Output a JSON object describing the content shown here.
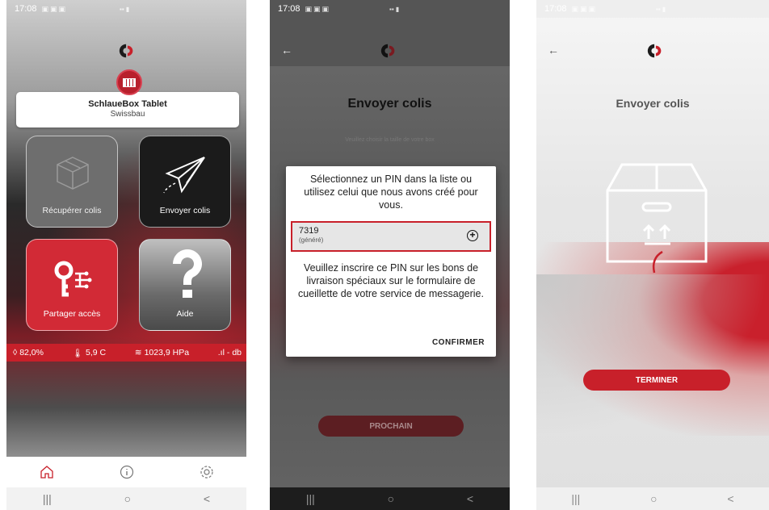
{
  "status_time": "17:08",
  "colors": {
    "brand_red": "#c8202a",
    "dark": "#1b1b1b"
  },
  "screen1": {
    "device_name": "SchlaueBox Tablet",
    "device_sub": "Swissbau",
    "tiles": {
      "recuperer": "Récupérer colis",
      "envoyer": "Envoyer colis",
      "partager": "Partager accès",
      "aide": "Aide"
    },
    "sensors": {
      "humidity": "82,0%",
      "temperature": "5,9 C",
      "pressure": "1023,9 HPa",
      "signal": "- db"
    },
    "nav_icons": [
      "home-icon",
      "info-icon",
      "gear-icon"
    ]
  },
  "screen2": {
    "title": "Envoyer colis",
    "subtitle": "Veuillez choisir la taille de votre box",
    "dialog": {
      "message": "Sélectionnez un PIN dans la liste ou utilisez celui que nous avons créé pour vous.",
      "pin_value": "7319",
      "pin_hint": "(généré)",
      "instructions": "Veuillez inscrire ce PIN sur les bons de livraison spéciaux sur le formulaire de cueillette de votre service de messagerie.",
      "confirm": "CONFIRMER"
    },
    "next_button": "PROCHAIN"
  },
  "screen3": {
    "title": "Envoyer colis",
    "finish_button": "TERMINER"
  },
  "system_nav": [
    "|||",
    "○",
    "<"
  ]
}
